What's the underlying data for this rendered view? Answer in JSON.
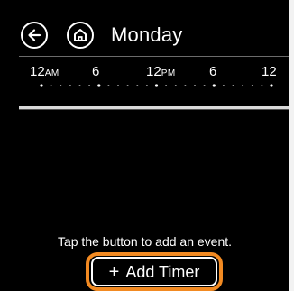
{
  "header": {
    "title": "Monday",
    "back_icon": "arrow-left-icon",
    "home_icon": "home-icon"
  },
  "timeline": {
    "labels": [
      {
        "main": "12",
        "suffix": "AM"
      },
      {
        "main": "6",
        "suffix": ""
      },
      {
        "main": "12",
        "suffix": "PM"
      },
      {
        "main": "6",
        "suffix": ""
      },
      {
        "main": "12",
        "suffix": ""
      }
    ]
  },
  "empty_state": {
    "message": "Tap the button to add an event."
  },
  "add_timer": {
    "icon": "plus-icon",
    "plus": "+",
    "label": "Add Timer"
  },
  "colors": {
    "background": "#000000",
    "foreground": "#ffffff",
    "highlight": "#f28a22"
  }
}
